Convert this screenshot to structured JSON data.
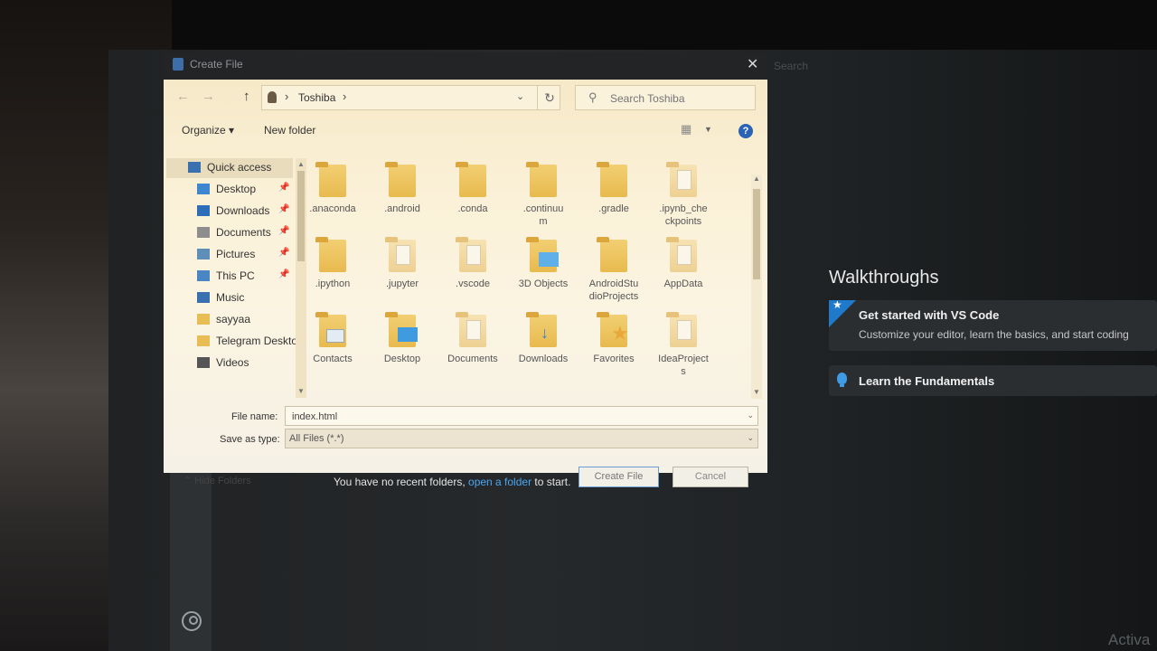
{
  "dialog": {
    "title": "Create File",
    "close": "✕",
    "nav": {
      "back": "←",
      "forward": "→",
      "up": "↑"
    },
    "address": {
      "crumb": "Toshiba",
      "separator": "›"
    },
    "search_placeholder": "Search Toshiba",
    "commands": {
      "organize": "Organize ▾",
      "new_folder": "New folder",
      "help": "?"
    },
    "nav_pane": [
      {
        "label": "Quick access",
        "icon": "star-icon",
        "pinned": false
      },
      {
        "label": "Desktop",
        "icon": "desktop-icon",
        "pinned": true
      },
      {
        "label": "Downloads",
        "icon": "downloads-icon",
        "pinned": true
      },
      {
        "label": "Documents",
        "icon": "documents-icon",
        "pinned": true
      },
      {
        "label": "Pictures",
        "icon": "pictures-icon",
        "pinned": true
      },
      {
        "label": "This PC",
        "icon": "computer-icon",
        "pinned": true
      },
      {
        "label": "Music",
        "icon": "music-icon",
        "pinned": false
      },
      {
        "label": "sayyaa",
        "icon": "folder-icon",
        "pinned": false
      },
      {
        "label": "Telegram Deskto",
        "icon": "folder-icon",
        "pinned": false
      },
      {
        "label": "Videos",
        "icon": "videos-icon",
        "pinned": false
      }
    ],
    "files": [
      {
        "name": ".anaconda",
        "icon": "folder-icon"
      },
      {
        "name": ".android",
        "icon": "folder-icon"
      },
      {
        "name": ".conda",
        "icon": "folder-icon"
      },
      {
        "name": ".continuum",
        "icon": "folder-icon"
      },
      {
        "name": ".gradle",
        "icon": "folder-icon"
      },
      {
        "name": ".ipynb_checkpoints",
        "icon": "folder-icon"
      },
      {
        "name": ".ipython",
        "icon": "folder-icon"
      },
      {
        "name": ".jupyter",
        "icon": "folder-icon"
      },
      {
        "name": ".vscode",
        "icon": "folder-icon"
      },
      {
        "name": "3D Objects",
        "icon": "3d-objects-folder-icon"
      },
      {
        "name": "AndroidStudioProjects",
        "icon": "folder-icon"
      },
      {
        "name": "AppData",
        "icon": "folder-icon"
      },
      {
        "name": "Contacts",
        "icon": "contacts-folder-icon"
      },
      {
        "name": "Desktop",
        "icon": "desktop-folder-icon"
      },
      {
        "name": "Documents",
        "icon": "documents-folder-icon"
      },
      {
        "name": "Downloads",
        "icon": "downloads-folder-icon"
      },
      {
        "name": "Favorites",
        "icon": "favorites-folder-icon"
      },
      {
        "name": "IdeaProjects",
        "icon": "folder-icon"
      }
    ],
    "file_name_label": "File name:",
    "file_name_value": "index.html",
    "save_as_type_label": "Save as type:",
    "save_as_type_value": "All Files (*.*)",
    "hide_folders": "Hide Folders",
    "create_button": "Create File",
    "cancel_button": "Cancel"
  },
  "vscode": {
    "search_placeholder": "Search",
    "walkthroughs_title": "Walkthroughs",
    "walkthroughs": [
      {
        "title": "Get started with VS Code",
        "description": "Customize your editor, learn the basics, and start coding"
      },
      {
        "title": "Learn the Fundamentals",
        "description": ""
      }
    ],
    "recent_prefix": "You have no recent folders,",
    "recent_link": "open a folder",
    "recent_suffix": "to start.",
    "watermark": "Activa"
  }
}
